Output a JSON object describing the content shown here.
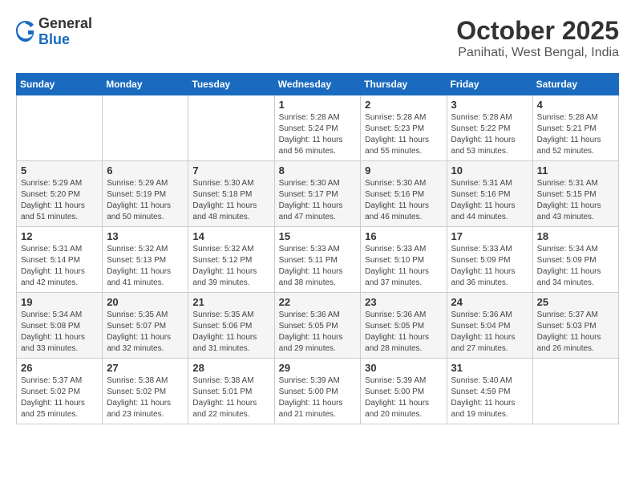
{
  "header": {
    "logo_general": "General",
    "logo_blue": "Blue",
    "title": "October 2025",
    "subtitle": "Panihati, West Bengal, India"
  },
  "weekdays": [
    "Sunday",
    "Monday",
    "Tuesday",
    "Wednesday",
    "Thursday",
    "Friday",
    "Saturday"
  ],
  "weeks": [
    [
      {
        "day": "",
        "info": ""
      },
      {
        "day": "",
        "info": ""
      },
      {
        "day": "",
        "info": ""
      },
      {
        "day": "1",
        "info": "Sunrise: 5:28 AM\nSunset: 5:24 PM\nDaylight: 11 hours and 56 minutes."
      },
      {
        "day": "2",
        "info": "Sunrise: 5:28 AM\nSunset: 5:23 PM\nDaylight: 11 hours and 55 minutes."
      },
      {
        "day": "3",
        "info": "Sunrise: 5:28 AM\nSunset: 5:22 PM\nDaylight: 11 hours and 53 minutes."
      },
      {
        "day": "4",
        "info": "Sunrise: 5:28 AM\nSunset: 5:21 PM\nDaylight: 11 hours and 52 minutes."
      }
    ],
    [
      {
        "day": "5",
        "info": "Sunrise: 5:29 AM\nSunset: 5:20 PM\nDaylight: 11 hours and 51 minutes."
      },
      {
        "day": "6",
        "info": "Sunrise: 5:29 AM\nSunset: 5:19 PM\nDaylight: 11 hours and 50 minutes."
      },
      {
        "day": "7",
        "info": "Sunrise: 5:30 AM\nSunset: 5:18 PM\nDaylight: 11 hours and 48 minutes."
      },
      {
        "day": "8",
        "info": "Sunrise: 5:30 AM\nSunset: 5:17 PM\nDaylight: 11 hours and 47 minutes."
      },
      {
        "day": "9",
        "info": "Sunrise: 5:30 AM\nSunset: 5:16 PM\nDaylight: 11 hours and 46 minutes."
      },
      {
        "day": "10",
        "info": "Sunrise: 5:31 AM\nSunset: 5:16 PM\nDaylight: 11 hours and 44 minutes."
      },
      {
        "day": "11",
        "info": "Sunrise: 5:31 AM\nSunset: 5:15 PM\nDaylight: 11 hours and 43 minutes."
      }
    ],
    [
      {
        "day": "12",
        "info": "Sunrise: 5:31 AM\nSunset: 5:14 PM\nDaylight: 11 hours and 42 minutes."
      },
      {
        "day": "13",
        "info": "Sunrise: 5:32 AM\nSunset: 5:13 PM\nDaylight: 11 hours and 41 minutes."
      },
      {
        "day": "14",
        "info": "Sunrise: 5:32 AM\nSunset: 5:12 PM\nDaylight: 11 hours and 39 minutes."
      },
      {
        "day": "15",
        "info": "Sunrise: 5:33 AM\nSunset: 5:11 PM\nDaylight: 11 hours and 38 minutes."
      },
      {
        "day": "16",
        "info": "Sunrise: 5:33 AM\nSunset: 5:10 PM\nDaylight: 11 hours and 37 minutes."
      },
      {
        "day": "17",
        "info": "Sunrise: 5:33 AM\nSunset: 5:09 PM\nDaylight: 11 hours and 36 minutes."
      },
      {
        "day": "18",
        "info": "Sunrise: 5:34 AM\nSunset: 5:09 PM\nDaylight: 11 hours and 34 minutes."
      }
    ],
    [
      {
        "day": "19",
        "info": "Sunrise: 5:34 AM\nSunset: 5:08 PM\nDaylight: 11 hours and 33 minutes."
      },
      {
        "day": "20",
        "info": "Sunrise: 5:35 AM\nSunset: 5:07 PM\nDaylight: 11 hours and 32 minutes."
      },
      {
        "day": "21",
        "info": "Sunrise: 5:35 AM\nSunset: 5:06 PM\nDaylight: 11 hours and 31 minutes."
      },
      {
        "day": "22",
        "info": "Sunrise: 5:36 AM\nSunset: 5:05 PM\nDaylight: 11 hours and 29 minutes."
      },
      {
        "day": "23",
        "info": "Sunrise: 5:36 AM\nSunset: 5:05 PM\nDaylight: 11 hours and 28 minutes."
      },
      {
        "day": "24",
        "info": "Sunrise: 5:36 AM\nSunset: 5:04 PM\nDaylight: 11 hours and 27 minutes."
      },
      {
        "day": "25",
        "info": "Sunrise: 5:37 AM\nSunset: 5:03 PM\nDaylight: 11 hours and 26 minutes."
      }
    ],
    [
      {
        "day": "26",
        "info": "Sunrise: 5:37 AM\nSunset: 5:02 PM\nDaylight: 11 hours and 25 minutes."
      },
      {
        "day": "27",
        "info": "Sunrise: 5:38 AM\nSunset: 5:02 PM\nDaylight: 11 hours and 23 minutes."
      },
      {
        "day": "28",
        "info": "Sunrise: 5:38 AM\nSunset: 5:01 PM\nDaylight: 11 hours and 22 minutes."
      },
      {
        "day": "29",
        "info": "Sunrise: 5:39 AM\nSunset: 5:00 PM\nDaylight: 11 hours and 21 minutes."
      },
      {
        "day": "30",
        "info": "Sunrise: 5:39 AM\nSunset: 5:00 PM\nDaylight: 11 hours and 20 minutes."
      },
      {
        "day": "31",
        "info": "Sunrise: 5:40 AM\nSunset: 4:59 PM\nDaylight: 11 hours and 19 minutes."
      },
      {
        "day": "",
        "info": ""
      }
    ]
  ]
}
